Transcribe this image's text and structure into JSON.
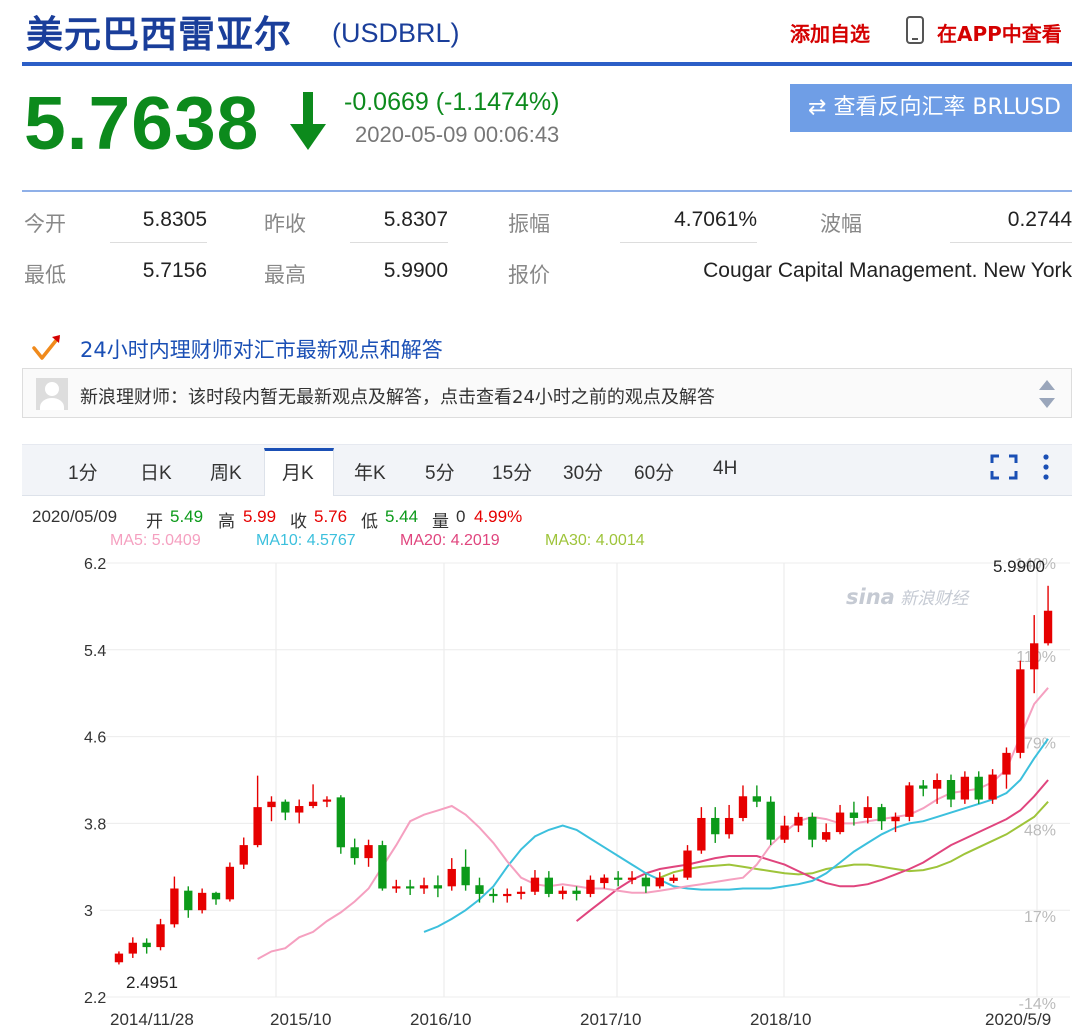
{
  "header": {
    "title": "美元巴西雷亚尔",
    "code": "(USDBRL)",
    "add_favorite": "添加自选",
    "app_view": "在APP中查看"
  },
  "quote": {
    "price": "5.7638",
    "change": "-0.0669 (-1.1474%)",
    "timestamp": "2020-05-09 00:06:43",
    "reverse_button": "查看反向汇率 BRLUSD"
  },
  "stats": {
    "open_label": "今开",
    "open": "5.8305",
    "prev_close_label": "昨收",
    "prev_close": "5.8307",
    "amplitude_label": "振幅",
    "amplitude": "4.7061%",
    "volatility_label": "波幅",
    "volatility": "0.2744",
    "low_label": "最低",
    "low": "5.7156",
    "high_label": "最高",
    "high": "5.9900",
    "quoter_label": "报价",
    "quoter": "Cougar Capital Management. New York"
  },
  "advisor": {
    "title": "24小时内理财师对汇市最新观点和解答",
    "message": "新浪理财师：该时段内暂无最新观点及解答，点击查看24小时之前的观点及解答"
  },
  "tabs": [
    "1分",
    "日K",
    "周K",
    "月K",
    "年K",
    "5分",
    "15分",
    "30分",
    "60分",
    "4H"
  ],
  "active_tab": "月K",
  "kline_info": {
    "date": "2020/05/09",
    "open_label": "开",
    "open": "5.49",
    "high_label": "高",
    "high": "5.99",
    "close_label": "收",
    "close": "5.76",
    "low_label": "低",
    "low": "5.44",
    "volume_label": "量",
    "volume": "0",
    "pct": "4.99%"
  },
  "ma": {
    "ma5": "MA5: 5.0409",
    "ma10": "MA10: 4.5767",
    "ma20": "MA20: 4.2019",
    "ma30": "MA30: 4.0014"
  },
  "colors": {
    "up": "#e60000",
    "down": "#0c9a1a",
    "ma5": "#f5a0c0",
    "ma10": "#3cc0dd",
    "ma20": "#e0457e",
    "ma30": "#9ec43a",
    "title": "#1a3e9a"
  },
  "watermark": {
    "logo": "sina",
    "text": "新浪财经"
  },
  "chart_data": {
    "type": "candlestick",
    "interval": "month",
    "y_ticks": [
      "6.2",
      "5.4",
      "4.6",
      "3.8",
      "3",
      "2.2"
    ],
    "ylim": [
      2.2,
      6.2
    ],
    "pct_ticks": [
      "140%",
      "110%",
      "79%",
      "48%",
      "17%",
      "-14%"
    ],
    "x_ticks": [
      "2014/11/28",
      "2015/10",
      "2016/10",
      "2017/10",
      "2018/10",
      "2020/5/9"
    ],
    "max_label": "5.9900",
    "min_label": "2.4951",
    "candles": [
      [
        2.52,
        2.6,
        2.62,
        2.5
      ],
      [
        2.6,
        2.7,
        2.75,
        2.56
      ],
      [
        2.7,
        2.66,
        2.74,
        2.6
      ],
      [
        2.66,
        2.87,
        2.92,
        2.63
      ],
      [
        2.87,
        3.2,
        3.31,
        2.84
      ],
      [
        3.18,
        3.0,
        3.22,
        2.93
      ],
      [
        3.0,
        3.16,
        3.2,
        2.97
      ],
      [
        3.16,
        3.1,
        3.17,
        3.05
      ],
      [
        3.1,
        3.4,
        3.44,
        3.08
      ],
      [
        3.42,
        3.6,
        3.67,
        3.38
      ],
      [
        3.6,
        3.95,
        4.24,
        3.58
      ],
      [
        3.95,
        4.0,
        4.05,
        3.82
      ],
      [
        4.0,
        3.9,
        4.02,
        3.83
      ],
      [
        3.9,
        3.96,
        4.02,
        3.8
      ],
      [
        3.96,
        4.0,
        4.16,
        3.94
      ],
      [
        4.0,
        4.02,
        4.05,
        3.95
      ],
      [
        4.04,
        3.58,
        4.06,
        3.52
      ],
      [
        3.58,
        3.48,
        3.66,
        3.42
      ],
      [
        3.48,
        3.6,
        3.65,
        3.4
      ],
      [
        3.6,
        3.2,
        3.64,
        3.18
      ],
      [
        3.2,
        3.22,
        3.28,
        3.16
      ],
      [
        3.22,
        3.2,
        3.28,
        3.14
      ],
      [
        3.2,
        3.23,
        3.3,
        3.15
      ],
      [
        3.23,
        3.2,
        3.32,
        3.12
      ],
      [
        3.22,
        3.38,
        3.48,
        3.18
      ],
      [
        3.4,
        3.23,
        3.56,
        3.18
      ],
      [
        3.23,
        3.15,
        3.3,
        3.07
      ],
      [
        3.15,
        3.13,
        3.2,
        3.07
      ],
      [
        3.13,
        3.15,
        3.2,
        3.07
      ],
      [
        3.15,
        3.17,
        3.22,
        3.1
      ],
      [
        3.17,
        3.3,
        3.37,
        3.14
      ],
      [
        3.3,
        3.15,
        3.36,
        3.12
      ],
      [
        3.15,
        3.18,
        3.22,
        3.1
      ],
      [
        3.18,
        3.15,
        3.22,
        3.09
      ],
      [
        3.15,
        3.28,
        3.32,
        3.12
      ],
      [
        3.25,
        3.3,
        3.33,
        3.2
      ],
      [
        3.3,
        3.28,
        3.36,
        3.22
      ],
      [
        3.28,
        3.3,
        3.36,
        3.24
      ],
      [
        3.3,
        3.22,
        3.33,
        3.16
      ],
      [
        3.22,
        3.3,
        3.35,
        3.2
      ],
      [
        3.27,
        3.3,
        3.33,
        3.25
      ],
      [
        3.3,
        3.55,
        3.6,
        3.28
      ],
      [
        3.55,
        3.85,
        3.95,
        3.52
      ],
      [
        3.85,
        3.7,
        3.95,
        3.62
      ],
      [
        3.7,
        3.85,
        3.97,
        3.66
      ],
      [
        3.85,
        4.05,
        4.15,
        3.82
      ],
      [
        4.05,
        4.0,
        4.15,
        3.95
      ],
      [
        4.0,
        3.65,
        4.05,
        3.6
      ],
      [
        3.65,
        3.78,
        3.87,
        3.62
      ],
      [
        3.78,
        3.86,
        3.9,
        3.72
      ],
      [
        3.86,
        3.65,
        3.9,
        3.58
      ],
      [
        3.65,
        3.72,
        3.8,
        3.63
      ],
      [
        3.72,
        3.9,
        3.97,
        3.7
      ],
      [
        3.9,
        3.85,
        4.0,
        3.78
      ],
      [
        3.85,
        3.95,
        4.05,
        3.8
      ],
      [
        3.95,
        3.82,
        3.98,
        3.74
      ],
      [
        3.82,
        3.86,
        3.9,
        3.72
      ],
      [
        3.86,
        4.15,
        4.18,
        3.82
      ],
      [
        4.15,
        4.12,
        4.2,
        4.05
      ],
      [
        4.12,
        4.2,
        4.26,
        3.98
      ],
      [
        4.2,
        4.02,
        4.25,
        3.95
      ],
      [
        4.02,
        4.23,
        4.28,
        3.98
      ],
      [
        4.23,
        4.02,
        4.28,
        3.98
      ],
      [
        4.02,
        4.25,
        4.3,
        3.98
      ],
      [
        4.25,
        4.45,
        4.5,
        4.12
      ],
      [
        4.45,
        5.22,
        5.3,
        4.4
      ],
      [
        5.22,
        5.46,
        5.72,
        5.0
      ],
      [
        5.46,
        5.76,
        5.99,
        5.44
      ]
    ],
    "ma5": [
      2.55,
      2.62,
      2.65,
      2.75,
      2.8,
      2.9,
      2.98,
      3.08,
      3.2,
      3.4,
      3.6,
      3.82,
      3.88,
      3.92,
      3.96,
      3.88,
      3.76,
      3.62,
      3.45,
      3.3,
      3.24,
      3.22,
      3.24,
      3.22,
      3.2,
      3.2,
      3.18,
      3.16,
      3.16,
      3.18,
      3.2,
      3.22,
      3.24,
      3.26,
      3.28,
      3.3,
      3.42,
      3.6,
      3.72,
      3.82,
      3.86,
      3.84,
      3.8,
      3.8,
      3.82,
      3.84,
      3.86,
      3.88,
      3.94,
      4.02,
      4.08,
      4.1,
      4.12,
      4.18,
      4.3,
      4.6,
      4.9,
      5.05
    ],
    "ma10": [
      2.8,
      2.85,
      2.92,
      3.0,
      3.1,
      3.22,
      3.4,
      3.56,
      3.68,
      3.74,
      3.78,
      3.74,
      3.66,
      3.58,
      3.5,
      3.42,
      3.34,
      3.28,
      3.22,
      3.2,
      3.19,
      3.19,
      3.19,
      3.2,
      3.2,
      3.2,
      3.22,
      3.24,
      3.27,
      3.34,
      3.44,
      3.54,
      3.62,
      3.7,
      3.76,
      3.8,
      3.82,
      3.86,
      3.9,
      3.94,
      3.98,
      4.02,
      4.08,
      4.2,
      4.4,
      4.58
    ],
    "ma20": [
      2.9,
      3.0,
      3.1,
      3.2,
      3.28,
      3.34,
      3.38,
      3.4,
      3.42,
      3.45,
      3.48,
      3.5,
      3.5,
      3.5,
      3.46,
      3.42,
      3.36,
      3.3,
      3.25,
      3.22,
      3.22,
      3.24,
      3.28,
      3.33,
      3.38,
      3.44,
      3.52,
      3.6,
      3.66,
      3.72,
      3.78,
      3.84,
      3.92,
      4.05,
      4.2
    ],
    "ma30": [
      3.3,
      3.35,
      3.38,
      3.4,
      3.41,
      3.42,
      3.4,
      3.38,
      3.36,
      3.34,
      3.33,
      3.34,
      3.38,
      3.4,
      3.42,
      3.42,
      3.4,
      3.38,
      3.36,
      3.37,
      3.4,
      3.45,
      3.52,
      3.58,
      3.64,
      3.7,
      3.78,
      3.86,
      4.0
    ]
  }
}
